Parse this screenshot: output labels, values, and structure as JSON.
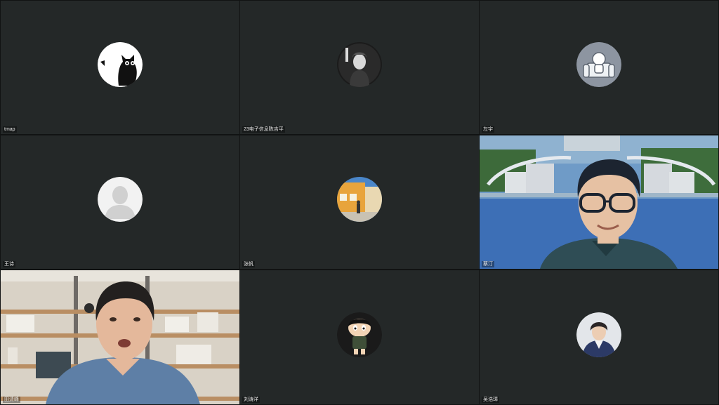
{
  "participants": [
    {
      "name": "tmap",
      "avatar": "cat-moon-icon"
    },
    {
      "name": "23电子信息陈吉平",
      "avatar": "joker-portrait-icon"
    },
    {
      "name": "左宇",
      "avatar": "sofa-character-icon"
    },
    {
      "name": "王诗",
      "avatar": "default-user-silhouette-icon"
    },
    {
      "name": "张帆",
      "avatar": "street-scene-icon"
    },
    {
      "name": "蔡汀",
      "avatar": "",
      "video": "campus-background-video"
    },
    {
      "name": "田清峰",
      "avatar": "",
      "video": "bookshelf-background-video"
    },
    {
      "name": "刘涛洋",
      "avatar": "cartoon-boy-icon"
    },
    {
      "name": "吴浩璋",
      "avatar": "student-photo-icon"
    }
  ],
  "colors": {
    "tile_bg": "#242828",
    "active_border": "#3fc36a"
  }
}
